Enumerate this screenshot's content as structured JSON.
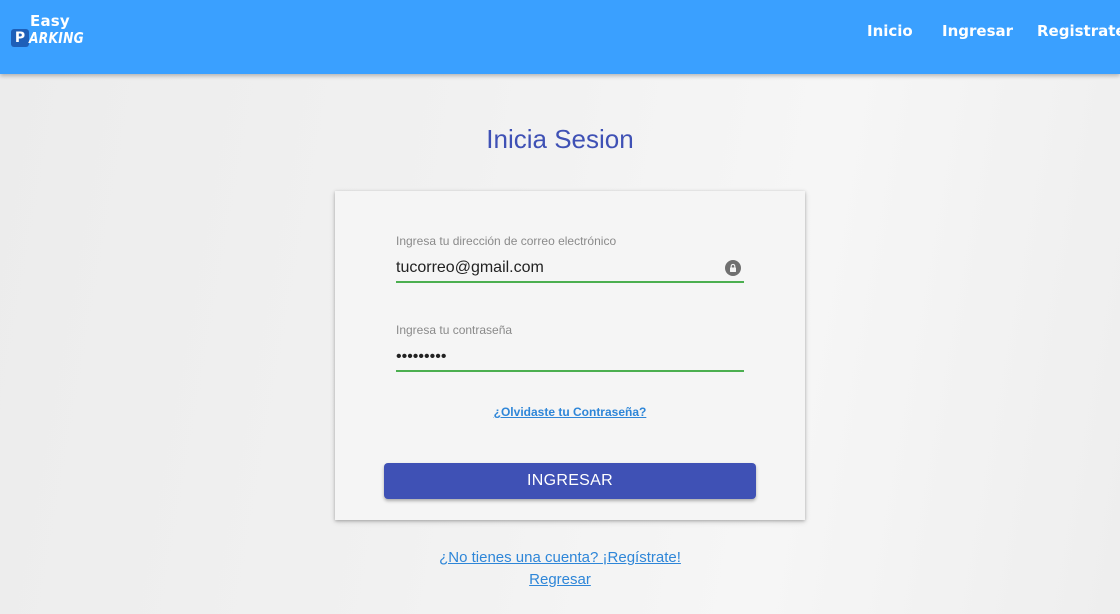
{
  "navbar": {
    "logo_top": "Easy",
    "logo_p": "P",
    "logo_rest": "ARKING",
    "links": [
      "Inicio",
      "Ingresar",
      "Registrate"
    ]
  },
  "page": {
    "title": "Inicia Sesion"
  },
  "form": {
    "email_label": "Ingresa tu dirección de correo electrónico",
    "email_value": "tucorreo@gmail.com",
    "password_label": "Ingresa tu contraseña",
    "password_value": "secretpwd",
    "forgot_link": "¿Olvidaste tu Contraseña?",
    "submit_label": "INGRESAR",
    "accent_color": "#4caf50"
  },
  "footer_links": {
    "register": "¿No tienes una cuenta? ¡Regístrate!",
    "back": "Regresar"
  },
  "colors": {
    "navbar": "#3aa0ff",
    "primary": "#3f51b5",
    "link": "#2e86d8"
  }
}
